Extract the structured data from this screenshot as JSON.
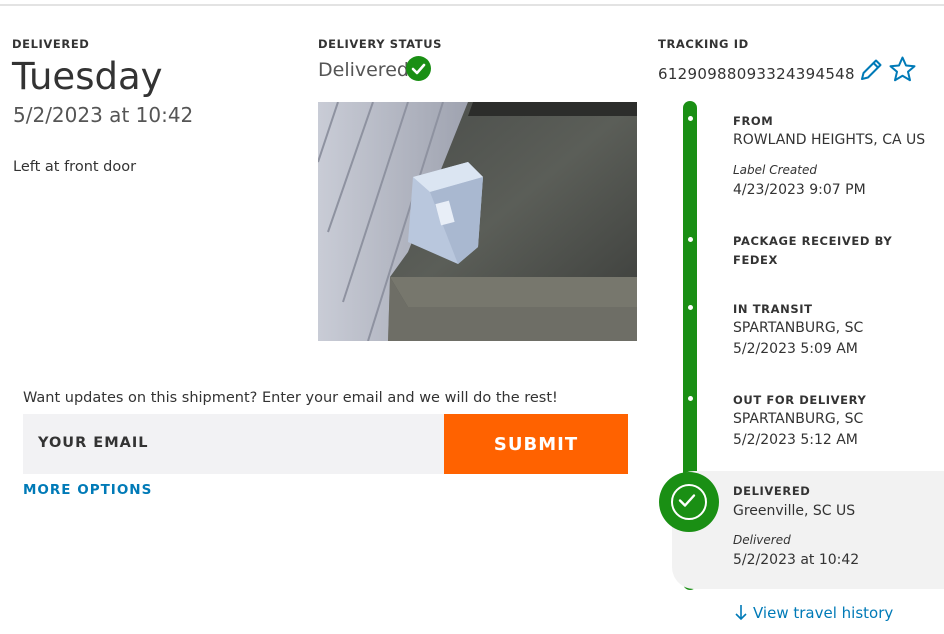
{
  "summary": {
    "delivered_label": "DELIVERED",
    "day": "Tuesday",
    "datetime": "5/2/2023 at 10:42",
    "location_note": "Left at front door"
  },
  "status": {
    "label": "DELIVERY STATUS",
    "value": "Delivered",
    "icon": "check-circle-icon",
    "color": "#1a8f14"
  },
  "tracking": {
    "label": "TRACKING ID",
    "id": "612909880933243945​48"
  },
  "email": {
    "prompt": "Want updates on this shipment? Enter your email and we will do the rest!",
    "placeholder": "YOUR EMAIL",
    "submit": "SUBMIT",
    "more_options": "MORE OPTIONS",
    "submit_color": "#ff6200"
  },
  "timeline": {
    "events": [
      {
        "title": "FROM",
        "line1": "ROWLAND HEIGHTS, CA US",
        "note": "Label Created",
        "line2": "4/23/2023 9:07 PM"
      },
      {
        "title": "PACKAGE RECEIVED BY",
        "title2": "FEDEX"
      },
      {
        "title": "IN TRANSIT",
        "line1": "SPARTANBURG, SC",
        "line2": "5/2/2023 5:09 AM"
      },
      {
        "title": "OUT FOR DELIVERY",
        "line1": "SPARTANBURG, SC",
        "line2": "5/2/2023 5:12 AM"
      },
      {
        "title": "DELIVERED",
        "line1": "Greenville, SC US",
        "note": "Delivered",
        "line2": "5/2/2023 at 10:42"
      }
    ],
    "history_link": "View travel history",
    "accent": "#1a8f14"
  },
  "link_color": "#007ab7"
}
